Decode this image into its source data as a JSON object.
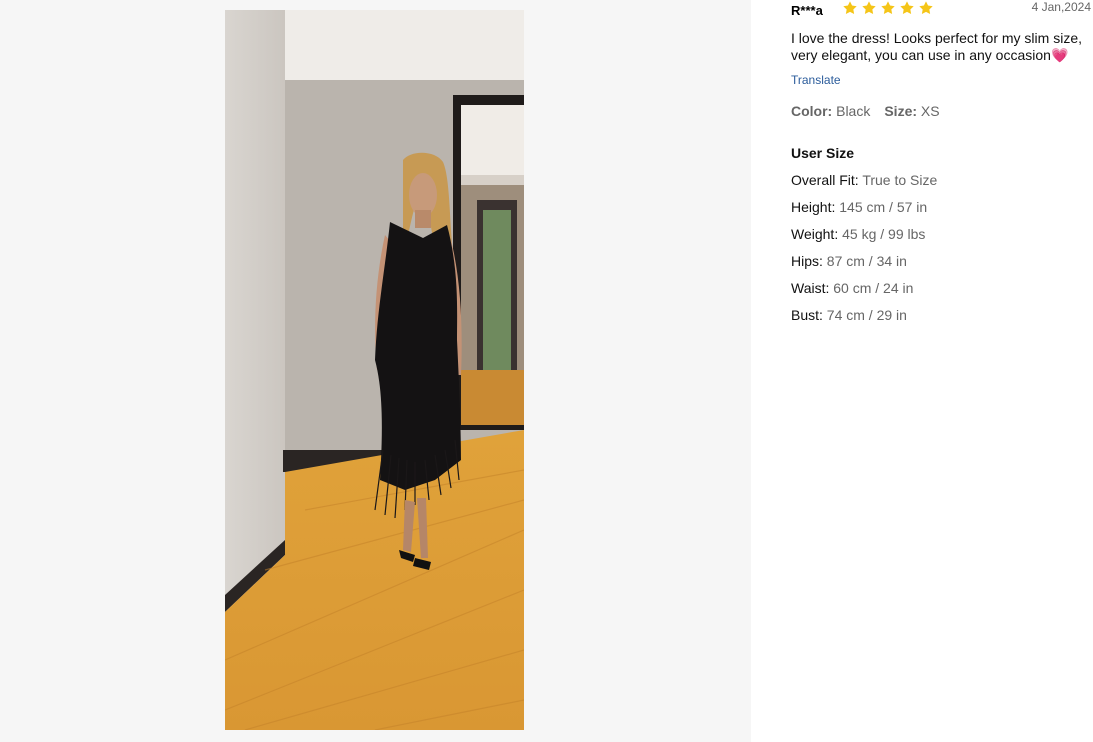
{
  "review": {
    "reviewer": "R***a",
    "rating": 5,
    "date": "4 Jan,2024",
    "text": "I love the dress! Looks perfect for my slim size, very elegant, you can use in any occasion",
    "emoji": "💗",
    "translate_label": "Translate",
    "color_label": "Color:",
    "color_value": "Black",
    "size_label": "Size:",
    "size_value": "XS"
  },
  "user_size": {
    "title": "User Size",
    "rows": [
      {
        "label": "Overall Fit:",
        "value": "True to Size"
      },
      {
        "label": "Height:",
        "value": "145 cm / 57 in"
      },
      {
        "label": "Weight:",
        "value": "45 kg / 99 lbs"
      },
      {
        "label": "Hips:",
        "value": "87 cm / 34 in"
      },
      {
        "label": "Waist:",
        "value": "60 cm / 24 in"
      },
      {
        "label": "Bust:",
        "value": "74 cm / 29 in"
      }
    ]
  },
  "colors": {
    "star": "#f5c518",
    "link": "#2b5c9b",
    "left_bg": "#f6f6f6"
  },
  "icons": {
    "star": "star-icon"
  }
}
